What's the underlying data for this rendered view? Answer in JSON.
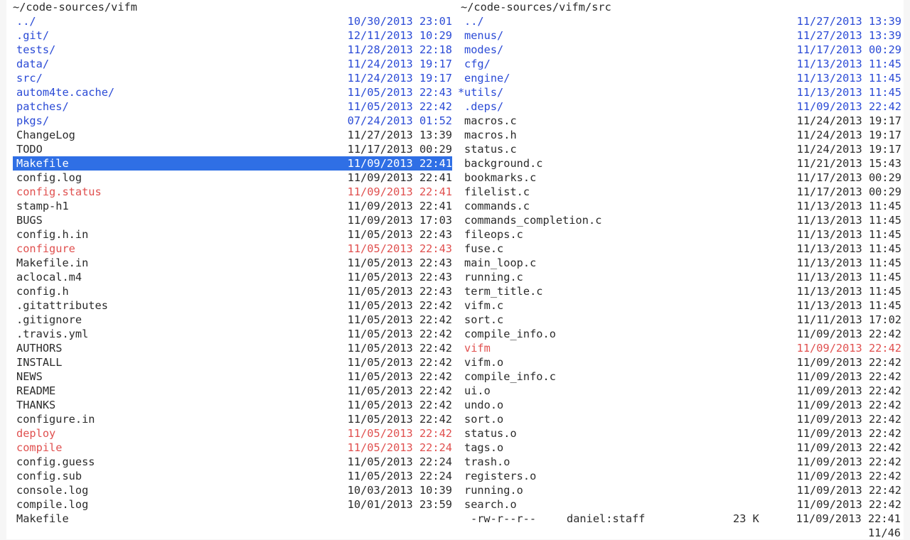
{
  "left_pane": {
    "path": "~/code-sources/vifm",
    "files": [
      {
        "name": "../",
        "date": "10/30/2013 23:01",
        "type": "dir"
      },
      {
        "name": ".git/",
        "date": "12/11/2013 10:29",
        "type": "dir"
      },
      {
        "name": "tests/",
        "date": "11/28/2013 22:18",
        "type": "dir"
      },
      {
        "name": "data/",
        "date": "11/24/2013 19:17",
        "type": "dir"
      },
      {
        "name": "src/",
        "date": "11/24/2013 19:17",
        "type": "dir"
      },
      {
        "name": "autom4te.cache/",
        "date": "11/05/2013 22:43",
        "type": "dir"
      },
      {
        "name": "patches/",
        "date": "11/05/2013 22:42",
        "type": "dir"
      },
      {
        "name": "pkgs/",
        "date": "07/24/2013 01:52",
        "type": "dir"
      },
      {
        "name": "ChangeLog",
        "date": "11/27/2013 13:39",
        "type": "file"
      },
      {
        "name": "TODO",
        "date": "11/17/2013 00:29",
        "type": "file"
      },
      {
        "name": "Makefile",
        "date": "11/09/2013 22:41",
        "type": "file",
        "selected": true
      },
      {
        "name": "config.log",
        "date": "11/09/2013 22:41",
        "type": "file"
      },
      {
        "name": "config.status",
        "date": "11/09/2013 22:41",
        "type": "exec"
      },
      {
        "name": "stamp-h1",
        "date": "11/09/2013 22:41",
        "type": "file"
      },
      {
        "name": "BUGS",
        "date": "11/09/2013 17:03",
        "type": "file"
      },
      {
        "name": "config.h.in",
        "date": "11/05/2013 22:43",
        "type": "file"
      },
      {
        "name": "configure",
        "date": "11/05/2013 22:43",
        "type": "exec"
      },
      {
        "name": "Makefile.in",
        "date": "11/05/2013 22:43",
        "type": "file"
      },
      {
        "name": "aclocal.m4",
        "date": "11/05/2013 22:43",
        "type": "file"
      },
      {
        "name": "config.h",
        "date": "11/05/2013 22:43",
        "type": "file"
      },
      {
        "name": ".gitattributes",
        "date": "11/05/2013 22:42",
        "type": "file"
      },
      {
        "name": ".gitignore",
        "date": "11/05/2013 22:42",
        "type": "file"
      },
      {
        "name": ".travis.yml",
        "date": "11/05/2013 22:42",
        "type": "file"
      },
      {
        "name": "AUTHORS",
        "date": "11/05/2013 22:42",
        "type": "file"
      },
      {
        "name": "INSTALL",
        "date": "11/05/2013 22:42",
        "type": "file"
      },
      {
        "name": "NEWS",
        "date": "11/05/2013 22:42",
        "type": "file"
      },
      {
        "name": "README",
        "date": "11/05/2013 22:42",
        "type": "file"
      },
      {
        "name": "THANKS",
        "date": "11/05/2013 22:42",
        "type": "file"
      },
      {
        "name": "configure.in",
        "date": "11/05/2013 22:42",
        "type": "file"
      },
      {
        "name": "deploy",
        "date": "11/05/2013 22:42",
        "type": "exec"
      },
      {
        "name": "compile",
        "date": "11/05/2013 22:24",
        "type": "exec"
      },
      {
        "name": "config.guess",
        "date": "11/05/2013 22:24",
        "type": "file"
      },
      {
        "name": "config.sub",
        "date": "11/05/2013 22:24",
        "type": "file"
      },
      {
        "name": "console.log",
        "date": "10/03/2013 10:39",
        "type": "file"
      },
      {
        "name": "compile.log",
        "date": "10/01/2013 23:59",
        "type": "file"
      }
    ]
  },
  "right_pane": {
    "path": "~/code-sources/vifm/src",
    "files": [
      {
        "name": "../",
        "date": "11/27/2013 13:39",
        "type": "dir"
      },
      {
        "name": "menus/",
        "date": "11/27/2013 13:39",
        "type": "dir"
      },
      {
        "name": "modes/",
        "date": "11/17/2013 00:29",
        "type": "dir"
      },
      {
        "name": "cfg/",
        "date": "11/13/2013 11:45",
        "type": "dir"
      },
      {
        "name": "engine/",
        "date": "11/13/2013 11:45",
        "type": "dir"
      },
      {
        "name": "utils/",
        "date": "11/13/2013 11:45",
        "type": "dir",
        "marked": true
      },
      {
        "name": ".deps/",
        "date": "11/09/2013 22:42",
        "type": "dir"
      },
      {
        "name": "macros.c",
        "date": "11/24/2013 19:17",
        "type": "file"
      },
      {
        "name": "macros.h",
        "date": "11/24/2013 19:17",
        "type": "file"
      },
      {
        "name": "status.c",
        "date": "11/24/2013 19:17",
        "type": "file"
      },
      {
        "name": "background.c",
        "date": "11/21/2013 15:43",
        "type": "file"
      },
      {
        "name": "bookmarks.c",
        "date": "11/17/2013 00:29",
        "type": "file"
      },
      {
        "name": "filelist.c",
        "date": "11/17/2013 00:29",
        "type": "file"
      },
      {
        "name": "commands.c",
        "date": "11/13/2013 11:45",
        "type": "file"
      },
      {
        "name": "commands_completion.c",
        "date": "11/13/2013 11:45",
        "type": "file"
      },
      {
        "name": "fileops.c",
        "date": "11/13/2013 11:45",
        "type": "file"
      },
      {
        "name": "fuse.c",
        "date": "11/13/2013 11:45",
        "type": "file"
      },
      {
        "name": "main_loop.c",
        "date": "11/13/2013 11:45",
        "type": "file"
      },
      {
        "name": "running.c",
        "date": "11/13/2013 11:45",
        "type": "file"
      },
      {
        "name": "term_title.c",
        "date": "11/13/2013 11:45",
        "type": "file"
      },
      {
        "name": "vifm.c",
        "date": "11/13/2013 11:45",
        "type": "file"
      },
      {
        "name": "sort.c",
        "date": "11/11/2013 17:02",
        "type": "file"
      },
      {
        "name": "compile_info.o",
        "date": "11/09/2013 22:42",
        "type": "file"
      },
      {
        "name": "vifm",
        "date": "11/09/2013 22:42",
        "type": "exec"
      },
      {
        "name": "vifm.o",
        "date": "11/09/2013 22:42",
        "type": "file"
      },
      {
        "name": "compile_info.c",
        "date": "11/09/2013 22:42",
        "type": "file"
      },
      {
        "name": "ui.o",
        "date": "11/09/2013 22:42",
        "type": "file"
      },
      {
        "name": "undo.o",
        "date": "11/09/2013 22:42",
        "type": "file"
      },
      {
        "name": "sort.o",
        "date": "11/09/2013 22:42",
        "type": "file"
      },
      {
        "name": "status.o",
        "date": "11/09/2013 22:42",
        "type": "file"
      },
      {
        "name": "tags.o",
        "date": "11/09/2013 22:42",
        "type": "file"
      },
      {
        "name": "trash.o",
        "date": "11/09/2013 22:42",
        "type": "file"
      },
      {
        "name": "registers.o",
        "date": "11/09/2013 22:42",
        "type": "file"
      },
      {
        "name": "running.o",
        "date": "11/09/2013 22:42",
        "type": "file"
      },
      {
        "name": "search.o",
        "date": "11/09/2013 22:42",
        "type": "file"
      }
    ]
  },
  "marker_symbol": "*",
  "status_bar": {
    "current_file": "Makefile",
    "permissions": "-rw-r--r--",
    "owner": "daniel:staff",
    "size": "23 K",
    "date": "11/09/2013 22:41",
    "position": "11/46"
  },
  "colors": {
    "directory": "#2b4bd6",
    "executable": "#e0504f",
    "selection_bg": "#2f6fe5",
    "text": "#2b2b2b"
  }
}
